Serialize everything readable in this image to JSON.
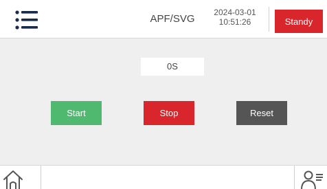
{
  "header": {
    "menu_icon": "hamburger-list-icon",
    "title": "APF/SVG",
    "date": "2024-03-01",
    "time": "10:51:26",
    "status_label": "Standy"
  },
  "timer": {
    "value": "0S"
  },
  "controls": {
    "start_label": "Start",
    "stop_label": "Stop",
    "reset_label": "Reset"
  },
  "footer": {
    "home_icon": "home-icon",
    "user_icon": "user-menu-icon"
  },
  "colors": {
    "start": "#4fba6f",
    "stop": "#d9262c",
    "reset": "#555555",
    "status": "#d9262c",
    "background": "#efefef"
  }
}
